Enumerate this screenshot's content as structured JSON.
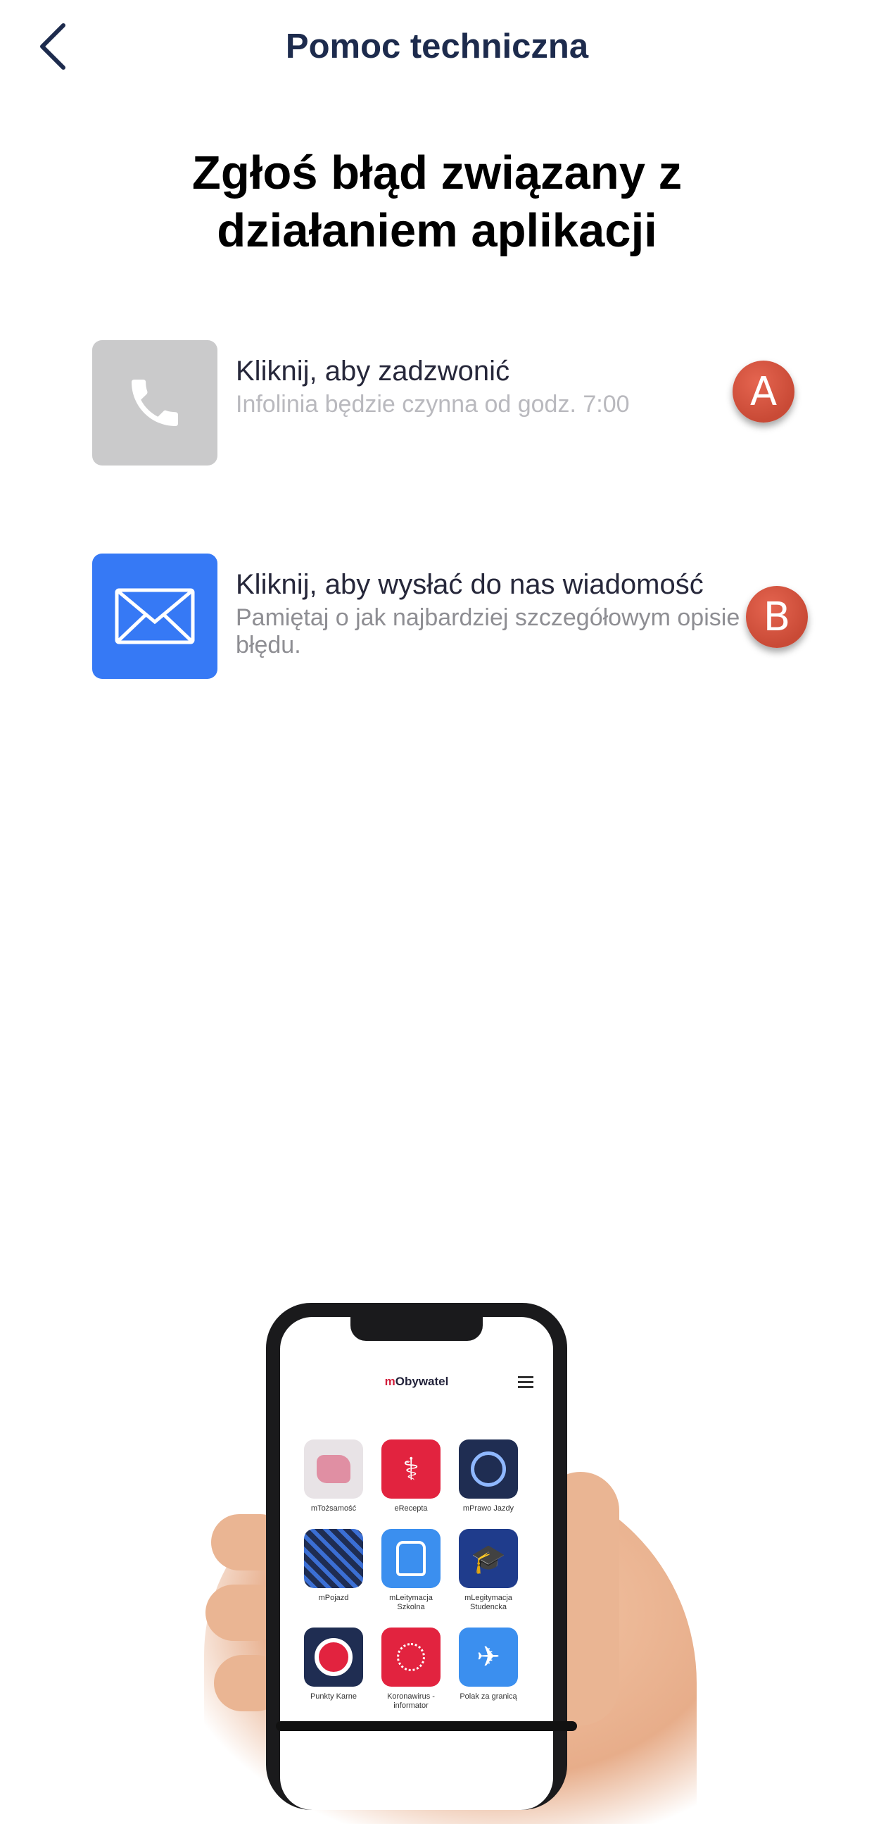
{
  "nav": {
    "title": "Pomoc techniczna",
    "back_icon": "chevron-left-icon"
  },
  "heading": {
    "line1": "Zgłoś błąd związany z",
    "line2": "działaniem aplikacji"
  },
  "options": [
    {
      "title": "Kliknij, aby zadzwonić",
      "subtitle": "Infolinia będzie czynna od godz. 7:00",
      "icon": "phone-icon",
      "badge": "A",
      "color": "#cacacb"
    },
    {
      "title": "Kliknij, aby wysłać do nas wiadomość",
      "subtitle": "Pamiętaj o jak najbardziej szczegółowym opisie błędu.",
      "icon": "mail-icon",
      "badge": "B",
      "color": "#3679f5"
    }
  ],
  "illustration": {
    "app_name_prefix": "m",
    "app_name_rest": "Obywatel",
    "apps": [
      {
        "label": "mTożsamość",
        "color": "#e8e3e6"
      },
      {
        "label": "eRecepta",
        "color": "#e2233f"
      },
      {
        "label": "mPrawo Jazdy",
        "color": "#1f2d52"
      },
      {
        "label": "mPojazd",
        "color": "#1f2d52"
      },
      {
        "label": "mLeitymacja Szkolna",
        "color": "#3b8fef"
      },
      {
        "label": "mLegitymacja Studencka",
        "color": "#1f3c8c"
      },
      {
        "label": "Punkty Karne",
        "color": "#1f2d52"
      },
      {
        "label": "Koronawirus - informator",
        "color": "#e2233f"
      },
      {
        "label": "Polak za granicą",
        "color": "#3b8fef"
      }
    ]
  }
}
